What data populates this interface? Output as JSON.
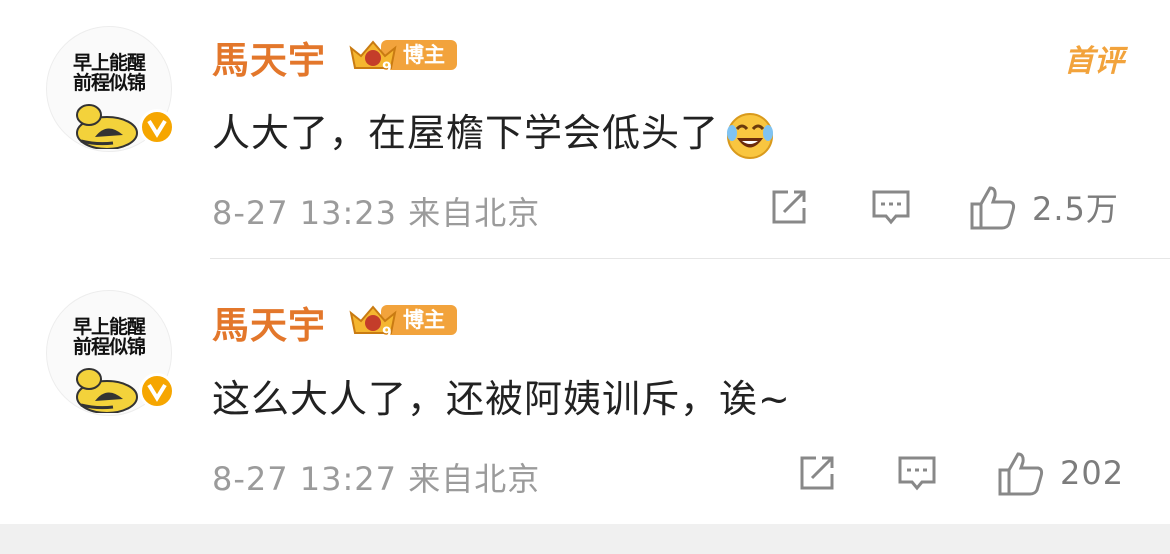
{
  "comments": [
    {
      "avatar_text_line1": "早上能醒",
      "avatar_text_line2": "前程似锦",
      "username": "馬天宇",
      "badge_label": "博主",
      "badge_level": "9",
      "first_tag": "首评",
      "text": "人大了，在屋檐下学会低头了",
      "emoji": "laughing-crying-emoji",
      "date": "8-27 13:23",
      "source": "来自北京",
      "likes": "2.5万"
    },
    {
      "avatar_text_line1": "早上能醒",
      "avatar_text_line2": "前程似锦",
      "username": "馬天宇",
      "badge_label": "博主",
      "badge_level": "9",
      "text": "这么大人了，还被阿姨训斥，诶~",
      "date": "8-27 13:27",
      "source": "来自北京",
      "likes": "202"
    }
  ],
  "colors": {
    "username": "#e3772b",
    "badge": "#f2a33c",
    "meta": "#9b9b9b",
    "body": "#222222"
  },
  "icons": [
    "share-icon",
    "reply-icon",
    "like-icon",
    "verified-v-icon",
    "crown-icon"
  ]
}
